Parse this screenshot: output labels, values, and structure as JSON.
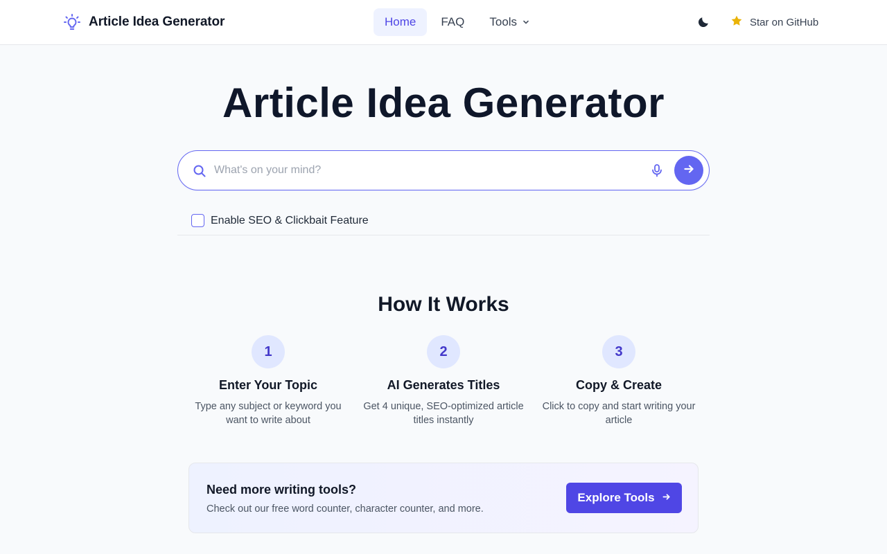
{
  "header": {
    "brand": "Article Idea Generator",
    "brand_icon": "lightbulb-icon",
    "nav": [
      {
        "label": "Home",
        "active": true
      },
      {
        "label": "FAQ",
        "active": false
      },
      {
        "label": "Tools",
        "active": false,
        "dropdown": true
      }
    ],
    "theme_icon": "moon-icon",
    "github_label": "Star on GitHub",
    "github_icon": "star-icon"
  },
  "hero": {
    "title": "Article Idea Generator",
    "search_placeholder": "What's on your mind?",
    "search_value": "",
    "seo_label": "Enable SEO & Clickbait Feature",
    "seo_checked": false
  },
  "how": {
    "title": "How It Works",
    "steps": [
      {
        "num": "1",
        "title": "Enter Your Topic",
        "desc": "Type any subject or keyword you want to write about"
      },
      {
        "num": "2",
        "title": "AI Generates Titles",
        "desc": "Get 4 unique, SEO-optimized article titles instantly"
      },
      {
        "num": "3",
        "title": "Copy & Create",
        "desc": "Click to copy and start writing your article"
      }
    ]
  },
  "cta": {
    "title": "Need more writing tools?",
    "desc": "Check out our free word counter, character counter, and more.",
    "button": "Explore Tools"
  },
  "colors": {
    "accent": "#6366f1",
    "accent_dark": "#4f46e5",
    "star": "#eab308",
    "background": "#f8fafc"
  }
}
